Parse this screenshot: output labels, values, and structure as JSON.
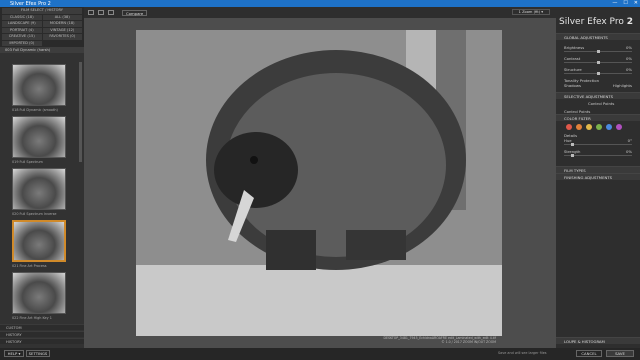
{
  "window": {
    "title": "Silver Efex Pro 2"
  },
  "left": {
    "tabs": [
      "FILM SELECT / HISTORY",
      "CLASSIC (18)",
      "ALL (38)",
      "LANDSCAPE (9)",
      "MODERN (18)",
      "PORTRAIT (4)",
      "VINTAGE (12)",
      "CREATIVE (15)",
      "FAVORITES (0)",
      "IMPORTED (0)"
    ],
    "preset_bar": "003 Full Dynamic (harsh)",
    "thumbs": [
      {
        "label": "018 Full Dynamic (smooth)"
      },
      {
        "label": "019 Full Spectrum"
      },
      {
        "label": "020 Full Spectrum Inverse"
      },
      {
        "label": "021 Fine Art Process"
      },
      {
        "label": "022 Fine Art High Key 1"
      }
    ],
    "categories": [
      "CUSTOM",
      "HISTORY",
      "HISTORY"
    ]
  },
  "toolbar": {
    "compare_label": "Compare",
    "zoom": "1 Zoom (fit) ▾"
  },
  "info": {
    "line1": "DESKTOP_3481_7945_EchidnaAROAFRE edit_Laminated_with_edit 4.tif",
    "line2": "© 1.0 / 2017 ZOOM IN/OUT ZOOM"
  },
  "right": {
    "brand_a": "Silver Efex Pro",
    "brand_b": "2",
    "global": "GLOBAL ADJUSTMENTS",
    "sliders": [
      {
        "label": "Brightness",
        "value": "0%"
      },
      {
        "label": "Contrast",
        "value": "0%"
      },
      {
        "label": "Structure",
        "value": "0%"
      }
    ],
    "tonality": "Tonality Protection",
    "shadows": "Shadows",
    "highlights": "Highlights",
    "selective": "SELECTIVE ADJUSTMENTS",
    "control_points": "Control Points",
    "color_filter": "COLOR FILTER",
    "filter_colors": [
      "#e0584a",
      "#e0803a",
      "#e0b84a",
      "#7ab24a",
      "#4a8ae0",
      "#b050c0"
    ],
    "details": "Details",
    "hue": "Hue",
    "hue_value": "0°",
    "strength": "Strength",
    "strength_value": "0%",
    "film_types": "FILM TYPES",
    "finishing": "FINISHING ADJUSTMENTS",
    "loupe": "LOUPE & HISTOGRAM"
  },
  "bottom": {
    "help": "HELP ▾",
    "settings": "SETTINGS",
    "status": "Save and will see larger files",
    "cancel": "CANCEL",
    "save": "SAVE"
  }
}
